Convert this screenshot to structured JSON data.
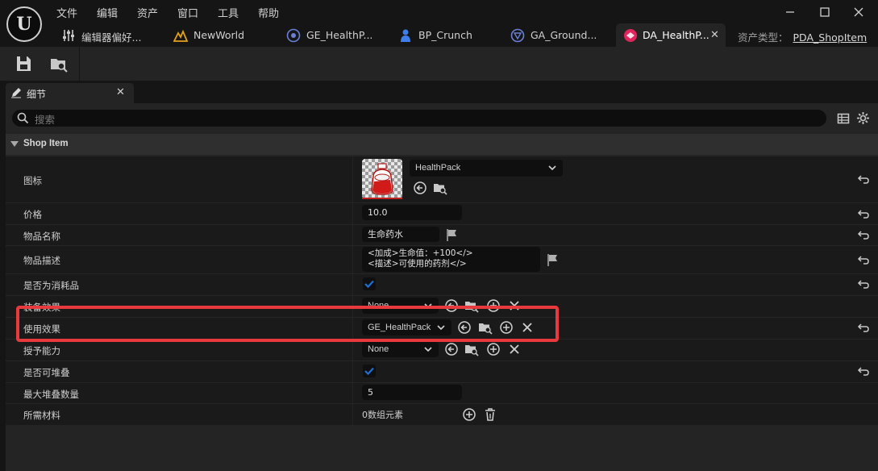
{
  "menu": {
    "file": "文件",
    "edit": "编辑",
    "asset": "资产",
    "window": "窗口",
    "tools": "工具",
    "help": "帮助"
  },
  "tabs": [
    {
      "label": "编辑器偏好...",
      "icon": "sliders-icon"
    },
    {
      "label": "NewWorld",
      "icon": "level-icon"
    },
    {
      "label": "GE_HealthP...",
      "icon": "gameplay-effect-icon"
    },
    {
      "label": "BP_Crunch",
      "icon": "character-blueprint-icon"
    },
    {
      "label": "GA_Ground...",
      "icon": "gameplay-ability-icon"
    },
    {
      "label": "DA_HealthP...",
      "icon": "data-asset-icon",
      "active": true
    }
  ],
  "asset_type": {
    "label": "资产类型：",
    "value": "PDA_ShopItem"
  },
  "details_tab": {
    "label": "细节"
  },
  "search": {
    "placeholder": "搜索"
  },
  "category": {
    "label": "Shop Item"
  },
  "properties": {
    "icon": {
      "name": "图标",
      "value": "HealthPack"
    },
    "price": {
      "name": "价格",
      "value": "10.0"
    },
    "item_name": {
      "name": "物品名称",
      "value": "生命药水"
    },
    "item_desc": {
      "name": "物品描述",
      "line1": "<加成>生命值：+100</>",
      "line2": "<描述>可使用的药剂</>"
    },
    "consumable": {
      "name": "是否为消耗品",
      "checked": true
    },
    "equip_effect": {
      "name": "装备效果",
      "value": "None"
    },
    "use_effect": {
      "name": "使用效果",
      "value": "GE_HealthPack"
    },
    "grant_ability": {
      "name": "授予能力",
      "value": "None"
    },
    "stackable": {
      "name": "是否可堆叠",
      "checked": true
    },
    "max_stack": {
      "name": "最大堆叠数量",
      "value": "5"
    },
    "materials": {
      "name": "所需材料",
      "value": "0数组元素"
    }
  },
  "colors": {
    "accent": "#1c6fd6",
    "highlight": "#e8393c",
    "active_tab_icon": "#e0245e"
  }
}
